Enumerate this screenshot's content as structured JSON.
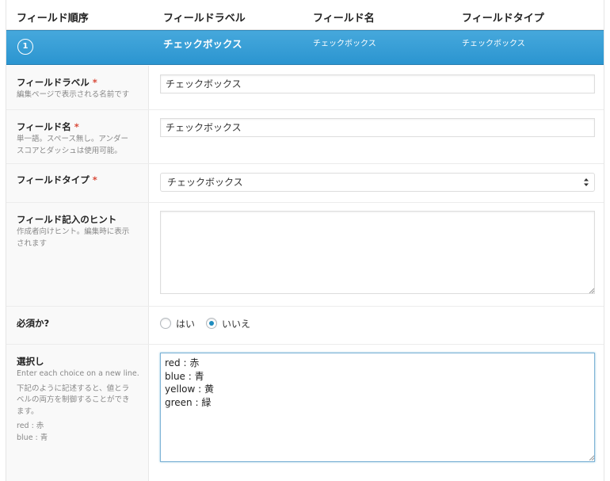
{
  "columns": {
    "order": "フィールド順序",
    "label": "フィールドラベル",
    "name": "フィールド名",
    "type": "フィールドタイプ"
  },
  "field": {
    "order": "1",
    "label": "チェックボックス",
    "name": "チェックボックス",
    "type": "チェックボックス"
  },
  "settings": {
    "label": {
      "title": "フィールドラベル",
      "required": "*",
      "desc": "編集ページで表示される名前です",
      "value": "チェックボックス"
    },
    "name": {
      "title": "フィールド名",
      "required": "*",
      "desc_lines": [
        "単一語。スペース無し。アンダー",
        "スコアとダッシュは使用可能。"
      ],
      "value": "チェックボックス"
    },
    "type": {
      "title": "フィールドタイプ",
      "required": "*",
      "value": "チェックボックス"
    },
    "hint": {
      "title": "フィールド記入のヒント",
      "desc_lines": [
        "作成者向けヒント。編集時に表示",
        "されます"
      ],
      "value": ""
    },
    "required": {
      "title": "必須か?",
      "options": [
        "はい",
        "いいえ"
      ],
      "selected": "いいえ"
    },
    "choices": {
      "title": "選択し",
      "desc_lines": [
        "Enter each choice on a new line.",
        "下記のように記述すると、値とラ",
        "ベルの両方を制御することができ",
        "ます。",
        "red : 赤",
        "blue : 青"
      ],
      "lines": [
        "red : 赤",
        "blue : 青",
        "yellow : 黄",
        "green : 緑"
      ]
    }
  },
  "colors": {
    "accent_bar": "#2b95d0",
    "required_star": "#d94b3a",
    "radio_selected": "#1e8cbe"
  }
}
